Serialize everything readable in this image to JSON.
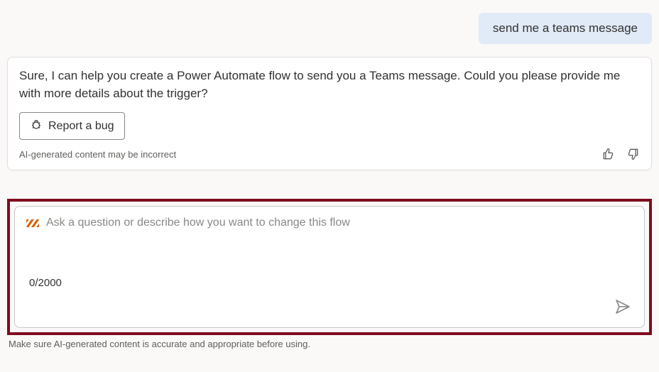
{
  "chat": {
    "user_message": "send me a teams message",
    "ai_response": "Sure, I can help you create a Power Automate flow to send you a Teams message. Could you please provide me with more details about the trigger?",
    "report_bug_label": "Report a bug",
    "disclaimer": "AI-generated content may be incorrect"
  },
  "input": {
    "placeholder": "Ask a question or describe how you want to change this flow",
    "counter": "0/2000",
    "max_chars": 2000
  },
  "footer": {
    "note": "Make sure AI-generated content is accurate and appropriate before using."
  }
}
